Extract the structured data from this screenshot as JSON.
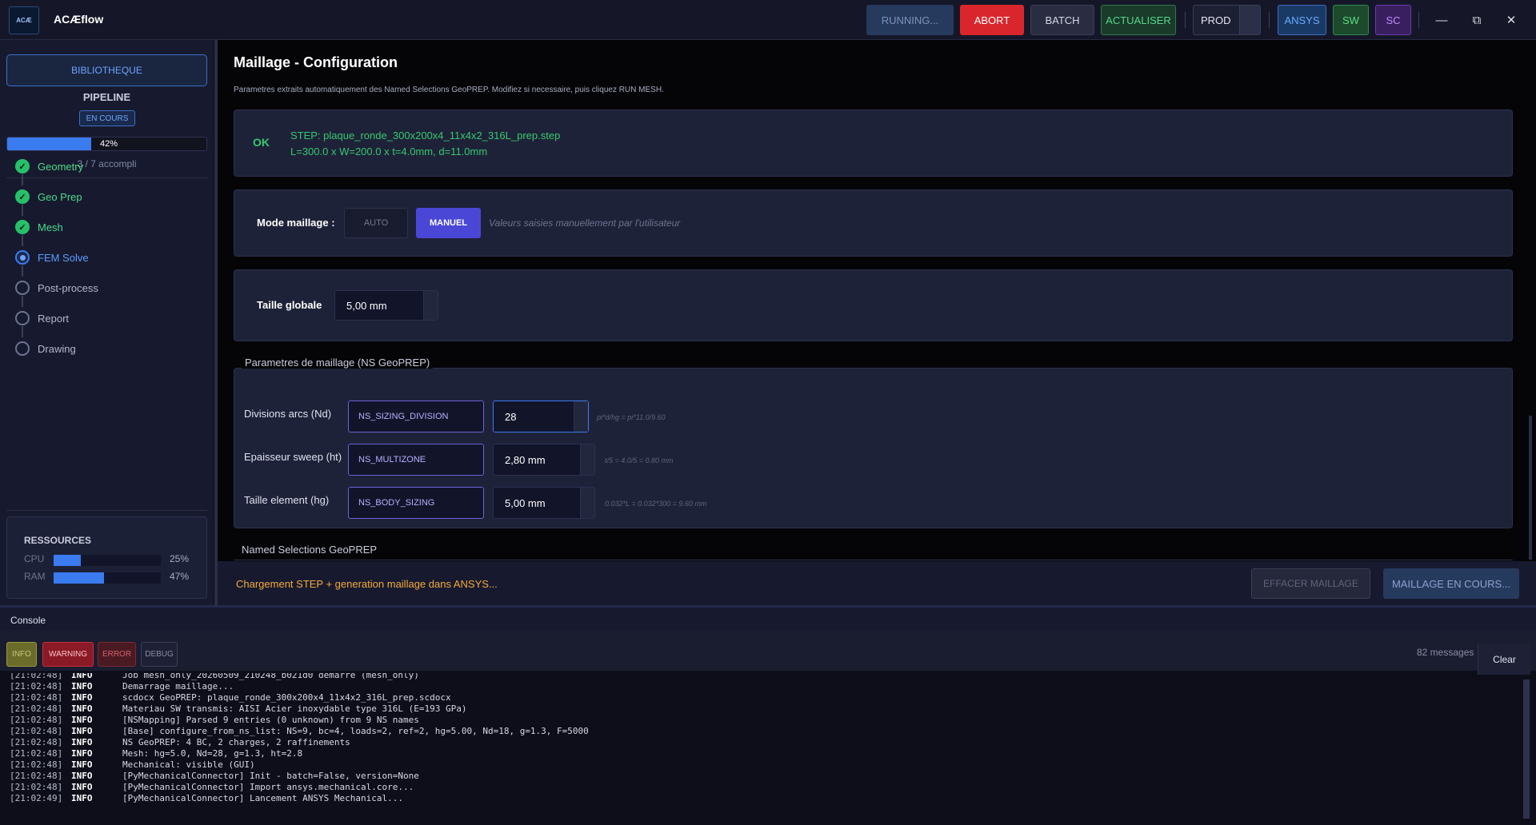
{
  "app": {
    "title": "ACÆflow",
    "logo_text": "ACÆ"
  },
  "toolbar": {
    "running": "RUNNING...",
    "abort": "ABORT",
    "batch": "BATCH",
    "actualiser": "ACTUALISER",
    "env_select": "PROD",
    "ansys": "ANSYS",
    "sw": "SW",
    "sc": "SC",
    "minimize": "—",
    "restore": "⧉",
    "close": "✕"
  },
  "sidebar": {
    "library_button": "BIBLIOTHEQUE",
    "pipeline_title": "PIPELINE",
    "status": "EN COURS",
    "progress_percent": 42,
    "progress_label": "42%",
    "progress_count": "3 / 7 accompli",
    "steps": [
      {
        "label": "Geometry",
        "state": "done"
      },
      {
        "label": "Geo Prep",
        "state": "done"
      },
      {
        "label": "Mesh",
        "state": "done"
      },
      {
        "label": "FEM Solve",
        "state": "active"
      },
      {
        "label": "Post-process",
        "state": "todo"
      },
      {
        "label": "Report",
        "state": "todo"
      },
      {
        "label": "Drawing",
        "state": "todo"
      }
    ],
    "resources": {
      "title": "RESSOURCES",
      "cpu_label": "CPU",
      "cpu_percent": 25,
      "cpu_value": "25%",
      "ram_label": "RAM",
      "ram_percent": 47,
      "ram_value": "47%"
    }
  },
  "main": {
    "title": "Maillage - Configuration",
    "subtitle": "Parametres extraits automatiquement des Named Selections GeoPREP. Modifiez si necessaire, puis cliquez RUN MESH.",
    "step_info": {
      "ok": "OK",
      "file": "STEP: plaque_ronde_300x200x4_11x4x2_316L_prep.step",
      "dims": "L=300.0 x W=200.0 x t=4.0mm, d=11.0mm"
    },
    "mode": {
      "label": "Mode maillage :",
      "auto": "AUTO",
      "manuel": "MANUEL",
      "hint": "Valeurs saisies manuellement par l'utilisateur"
    },
    "global_size": {
      "label": "Taille globale",
      "value": "5,00 mm"
    },
    "params": {
      "legend": "Parametres de maillage (NS GeoPREP)",
      "rows": [
        {
          "label": "Divisions arcs (Nd)",
          "ns": "NS_SIZING_DIVISION",
          "value": "28",
          "formula": "pi*d/hg = pi*11.0/9.60"
        },
        {
          "label": "Epaisseur sweep (ht)",
          "ns": "NS_MULTIZONE",
          "value": "2,80 mm",
          "formula": "t/5 = 4.0/5 = 0.80 mm"
        },
        {
          "label": "Taille element (hg)",
          "ns": "NS_BODY_SIZING",
          "value": "5,00 mm",
          "formula": "0.032*L = 0.032*300 = 9.60 mm"
        }
      ]
    },
    "ns_legend": "Named Selections GeoPREP",
    "status_message": "Chargement STEP + generation maillage dans ANSYS...",
    "clear_mesh_button": "EFFACER MAILLAGE",
    "mesh_button": "MAILLAGE EN COURS..."
  },
  "console": {
    "title": "Console",
    "filters": {
      "info": "INFO",
      "warning": "WARNING",
      "error": "ERROR",
      "debug": "DEBUG"
    },
    "message_count": "82 messages",
    "clear": "Clear",
    "lines": [
      {
        "time": "[21:02:48]",
        "level": "INFO",
        "msg": "Job mesh_only_20260509_210248_b021d0 demarre (mesh_only)"
      },
      {
        "time": "[21:02:48]",
        "level": "INFO",
        "msg": "Demarrage maillage..."
      },
      {
        "time": "[21:02:48]",
        "level": "INFO",
        "msg": "scdocx GeoPREP: plaque_ronde_300x200x4_11x4x2_316L_prep.scdocx"
      },
      {
        "time": "[21:02:48]",
        "level": "INFO",
        "msg": "Materiau SW transmis: AISI Acier inoxydable type 316L (E=193 GPa)"
      },
      {
        "time": "[21:02:48]",
        "level": "INFO",
        "msg": "[NSMapping] Parsed 9 entries (0 unknown) from 9 NS names"
      },
      {
        "time": "[21:02:48]",
        "level": "INFO",
        "msg": "[Base] configure_from_ns_list: NS=9, bc=4, loads=2, ref=2, hg=5.00, Nd=18, g=1.3, F=5000"
      },
      {
        "time": "[21:02:48]",
        "level": "INFO",
        "msg": "NS GeoPREP: 4 BC, 2 charges, 2 raffinements"
      },
      {
        "time": "[21:02:48]",
        "level": "INFO",
        "msg": "Mesh: hg=5.0, Nd=28, g=1.3, ht=2.8"
      },
      {
        "time": "[21:02:48]",
        "level": "INFO",
        "msg": "Mechanical: visible (GUI)"
      },
      {
        "time": "[21:02:48]",
        "level": "INFO",
        "msg": "[PyMechanicalConnector] Init - batch=False, version=None"
      },
      {
        "time": "[21:02:48]",
        "level": "INFO",
        "msg": "[PyMechanicalConnector] Import ansys.mechanical.core..."
      },
      {
        "time": "[21:02:49]",
        "level": "INFO",
        "msg": "[PyMechanicalConnector] Lancement ANSYS Mechanical..."
      }
    ]
  }
}
